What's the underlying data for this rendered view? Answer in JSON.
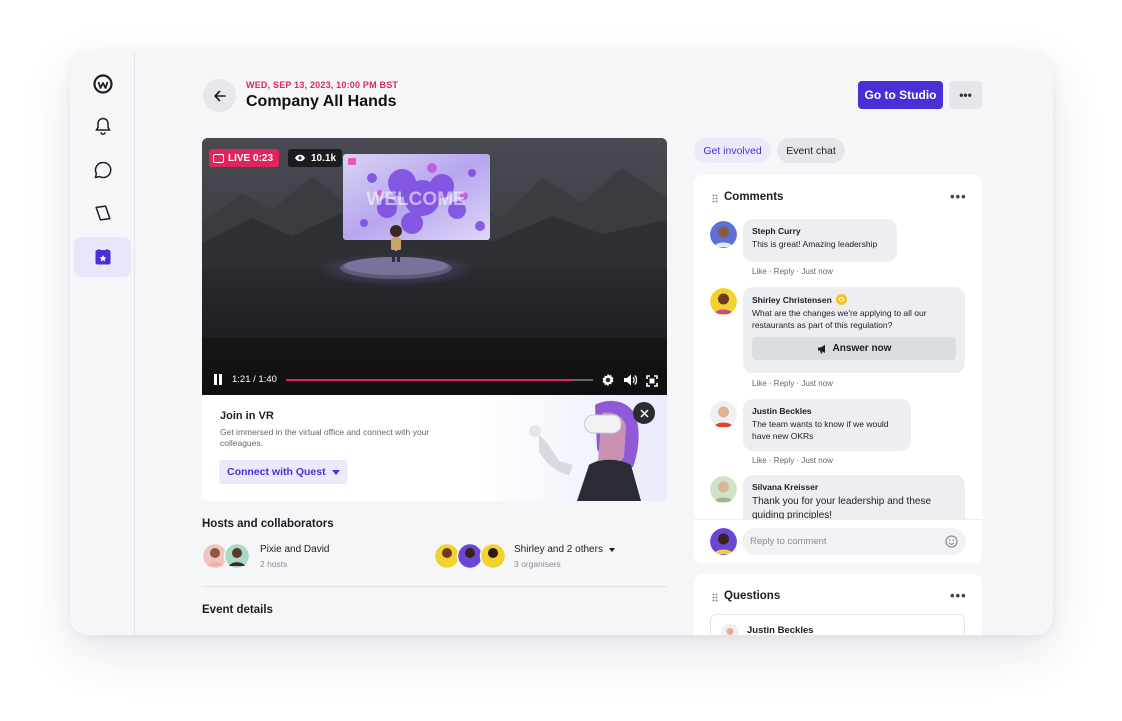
{
  "event": {
    "date": "WED, SEP 13, 2023, 10:00 PM BST",
    "title": "Company All Hands",
    "studio_label": "Go to Studio",
    "more_label": "•••"
  },
  "video": {
    "live_label": "LIVE 0:23",
    "viewers": "10.1k",
    "screen_text": "WELCOME",
    "time": "1:21 / 1:40",
    "progress": 0.93
  },
  "vr": {
    "title": "Join in VR",
    "description": "Get immersed in the virtual office and connect with your colleagues.",
    "button": "Connect with Quest"
  },
  "hosts": {
    "heading": "Hosts and collaborators",
    "group1": {
      "name": "Pixie and David",
      "sub": "2 hosts"
    },
    "group2": {
      "name": "Shirley and 2 others",
      "sub": "3 organisers"
    }
  },
  "event_details": {
    "heading": "Event details"
  },
  "tabs": {
    "get_involved": "Get involved",
    "event_chat": "Event chat"
  },
  "comments": {
    "heading": "Comments",
    "items": [
      {
        "name": "Steph Curry",
        "text": "This is great! Amazing leadership",
        "meta": "Like · Reply · Just now"
      },
      {
        "name": "Shirley Christensen",
        "text": "What are the changes we're applying to all our restaurants as part of this regulation?",
        "meta": "Like · Reply · Just now",
        "action": "Answer now"
      },
      {
        "name": "Justin Beckles",
        "text": "The team wants to know if we would have new OKRs",
        "meta": "Like · Reply · Just now"
      },
      {
        "name": "Silvana Kreisser",
        "text": "Thank you for your leadership and these guiding principles!"
      }
    ],
    "reply_placeholder": "Reply to comment"
  },
  "questions": {
    "heading": "Questions",
    "first_name": "Justin Beckles"
  },
  "colors": {
    "accent": "#4b2fd6",
    "live": "#e0245e",
    "progress": "#e0245e"
  }
}
